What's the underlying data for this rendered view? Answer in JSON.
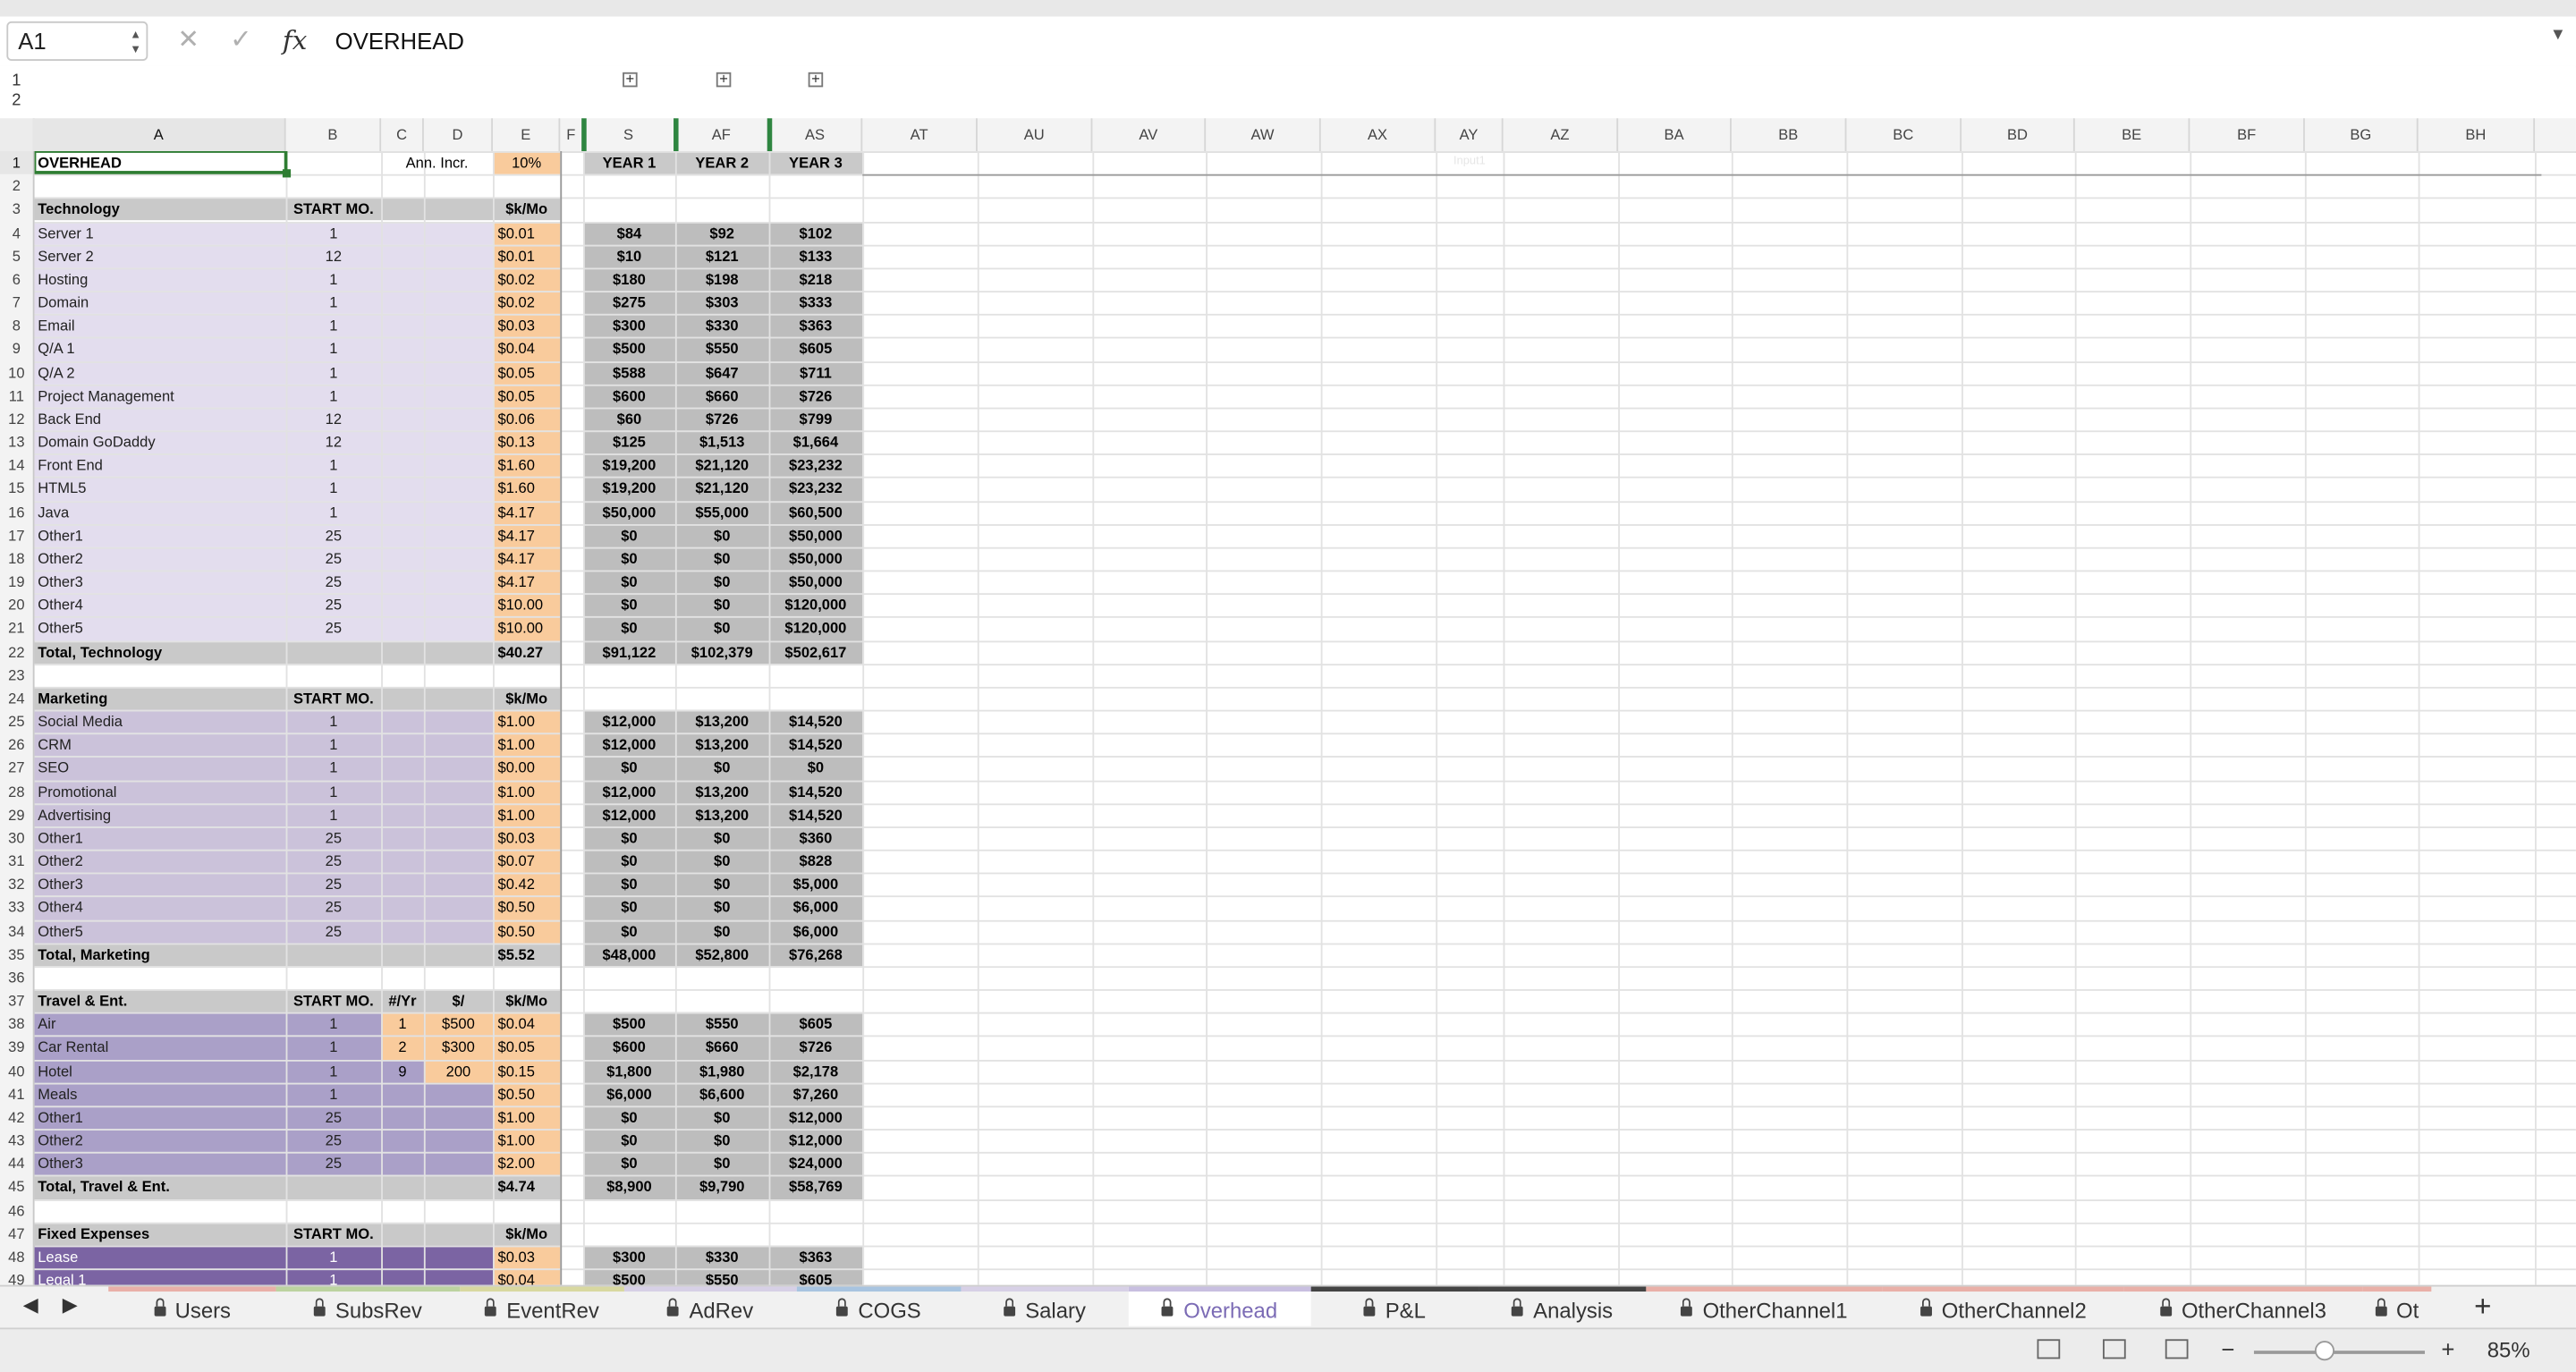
{
  "formula_bar": {
    "name_box": "A1",
    "formula": "OVERHEAD",
    "cancel_icon": "x-icon",
    "enter_icon": "check-icon",
    "fx_label": "fx"
  },
  "outline_levels": [
    "1",
    "2"
  ],
  "columns": [
    "A",
    "B",
    "C",
    "D",
    "E",
    "F",
    "S",
    "AF",
    "AS",
    "AT",
    "AU",
    "AV",
    "AW",
    "AX",
    "AY",
    "AZ",
    "BA",
    "BB",
    "BC",
    "BD",
    "BE",
    "BF",
    "BG",
    "BH"
  ],
  "colors": {
    "tech_bg": "#e3ddee",
    "mkt_bg": "#cbc2da",
    "travel_bg": "#aaa0c8",
    "fixed_bg": "#7b64a3",
    "orange": "#f9cb9c",
    "gray": "#bdbdbd",
    "header_gray": "#c9c9c9",
    "selection": "#2e7d32"
  },
  "sheet": {
    "a1": "OVERHEAD",
    "ann_incr_label": "Ann. Incr.",
    "ann_incr_value": "10%",
    "year_headers": [
      "YEAR 1",
      "YEAR 2",
      "YEAR 3"
    ],
    "ay_faint": "Input1",
    "start_mo_label": "START MO.",
    "unit_label": "$k/Mo",
    "yr_label": "#/Yr",
    "dollar_label": "$/",
    "sections": [
      {
        "name": "Technology",
        "header_row": 3,
        "theme": "tech",
        "rows": [
          {
            "n": 4,
            "label": "Server 1",
            "start": "1",
            "e": "$0.01",
            "y1": "$84",
            "y2": "$92",
            "y3": "$102"
          },
          {
            "n": 5,
            "label": "Server 2",
            "start": "12",
            "e": "$0.01",
            "y1": "$10",
            "y2": "$121",
            "y3": "$133"
          },
          {
            "n": 6,
            "label": "Hosting",
            "start": "1",
            "e": "$0.02",
            "y1": "$180",
            "y2": "$198",
            "y3": "$218"
          },
          {
            "n": 7,
            "label": "Domain",
            "start": "1",
            "e": "$0.02",
            "y1": "$275",
            "y2": "$303",
            "y3": "$333"
          },
          {
            "n": 8,
            "label": "Email",
            "start": "1",
            "e": "$0.03",
            "y1": "$300",
            "y2": "$330",
            "y3": "$363"
          },
          {
            "n": 9,
            "label": "Q/A 1",
            "start": "1",
            "e": "$0.04",
            "y1": "$500",
            "y2": "$550",
            "y3": "$605"
          },
          {
            "n": 10,
            "label": "Q/A 2",
            "start": "1",
            "e": "$0.05",
            "y1": "$588",
            "y2": "$647",
            "y3": "$711"
          },
          {
            "n": 11,
            "label": "Project Management",
            "start": "1",
            "e": "$0.05",
            "y1": "$600",
            "y2": "$660",
            "y3": "$726"
          },
          {
            "n": 12,
            "label": "Back End",
            "start": "12",
            "e": "$0.06",
            "y1": "$60",
            "y2": "$726",
            "y3": "$799"
          },
          {
            "n": 13,
            "label": "Domain GoDaddy",
            "start": "12",
            "e": "$0.13",
            "y1": "$125",
            "y2": "$1,513",
            "y3": "$1,664"
          },
          {
            "n": 14,
            "label": "Front End",
            "start": "1",
            "e": "$1.60",
            "y1": "$19,200",
            "y2": "$21,120",
            "y3": "$23,232"
          },
          {
            "n": 15,
            "label": "HTML5",
            "start": "1",
            "e": "$1.60",
            "y1": "$19,200",
            "y2": "$21,120",
            "y3": "$23,232"
          },
          {
            "n": 16,
            "label": "Java",
            "start": "1",
            "e": "$4.17",
            "y1": "$50,000",
            "y2": "$55,000",
            "y3": "$60,500"
          },
          {
            "n": 17,
            "label": "Other1",
            "start": "25",
            "e": "$4.17",
            "y1": "$0",
            "y2": "$0",
            "y3": "$50,000"
          },
          {
            "n": 18,
            "label": "Other2",
            "start": "25",
            "e": "$4.17",
            "y1": "$0",
            "y2": "$0",
            "y3": "$50,000"
          },
          {
            "n": 19,
            "label": "Other3",
            "start": "25",
            "e": "$4.17",
            "y1": "$0",
            "y2": "$0",
            "y3": "$50,000"
          },
          {
            "n": 20,
            "label": "Other4",
            "start": "25",
            "e": "$10.00",
            "y1": "$0",
            "y2": "$0",
            "y3": "$120,000"
          },
          {
            "n": 21,
            "label": "Other5",
            "start": "25",
            "e": "$10.00",
            "y1": "$0",
            "y2": "$0",
            "y3": "$120,000"
          }
        ],
        "total": {
          "n": 22,
          "label": "Total, Technology",
          "e": "$40.27",
          "y1": "$91,122",
          "y2": "$102,379",
          "y3": "$502,617"
        }
      },
      {
        "name": "Marketing",
        "header_row": 24,
        "theme": "mkt",
        "rows": [
          {
            "n": 25,
            "label": "Social Media",
            "start": "1",
            "e": "$1.00",
            "y1": "$12,000",
            "y2": "$13,200",
            "y3": "$14,520"
          },
          {
            "n": 26,
            "label": "CRM",
            "start": "1",
            "e": "$1.00",
            "y1": "$12,000",
            "y2": "$13,200",
            "y3": "$14,520"
          },
          {
            "n": 27,
            "label": "SEO",
            "start": "1",
            "e": "$0.00",
            "y1": "$0",
            "y2": "$0",
            "y3": "$0"
          },
          {
            "n": 28,
            "label": "Promotional",
            "start": "1",
            "e": "$1.00",
            "y1": "$12,000",
            "y2": "$13,200",
            "y3": "$14,520"
          },
          {
            "n": 29,
            "label": "Advertising",
            "start": "1",
            "e": "$1.00",
            "y1": "$12,000",
            "y2": "$13,200",
            "y3": "$14,520"
          },
          {
            "n": 30,
            "label": "Other1",
            "start": "25",
            "e": "$0.03",
            "y1": "$0",
            "y2": "$0",
            "y3": "$360"
          },
          {
            "n": 31,
            "label": "Other2",
            "start": "25",
            "e": "$0.07",
            "y1": "$0",
            "y2": "$0",
            "y3": "$828"
          },
          {
            "n": 32,
            "label": "Other3",
            "start": "25",
            "e": "$0.42",
            "y1": "$0",
            "y2": "$0",
            "y3": "$5,000"
          },
          {
            "n": 33,
            "label": "Other4",
            "start": "25",
            "e": "$0.50",
            "y1": "$0",
            "y2": "$0",
            "y3": "$6,000"
          },
          {
            "n": 34,
            "label": "Other5",
            "start": "25",
            "e": "$0.50",
            "y1": "$0",
            "y2": "$0",
            "y3": "$6,000"
          }
        ],
        "total": {
          "n": 35,
          "label": "Total, Marketing",
          "e": "$5.52",
          "y1": "$48,000",
          "y2": "$52,800",
          "y3": "$76,268"
        }
      },
      {
        "name": "Travel & Ent.",
        "header_row": 37,
        "theme": "travel",
        "extra_headers": true,
        "rows": [
          {
            "n": 38,
            "label": "Air",
            "start": "1",
            "c": "1",
            "d": "$500",
            "e": "$0.04",
            "y1": "$500",
            "y2": "$550",
            "y3": "$605"
          },
          {
            "n": 39,
            "label": "Car Rental",
            "start": "1",
            "c": "2",
            "d": "$300",
            "e": "$0.05",
            "y1": "$600",
            "y2": "$660",
            "y3": "$726"
          },
          {
            "n": 40,
            "label": "Hotel",
            "start": "1",
            "c": "9",
            "d": "200",
            "e": "$0.15",
            "y1": "$1,800",
            "y2": "$1,980",
            "y3": "$2,178"
          },
          {
            "n": 41,
            "label": "Meals",
            "start": "1",
            "e": "$0.50",
            "y1": "$6,000",
            "y2": "$6,600",
            "y3": "$7,260"
          },
          {
            "n": 42,
            "label": "Other1",
            "start": "25",
            "e": "$1.00",
            "y1": "$0",
            "y2": "$0",
            "y3": "$12,000"
          },
          {
            "n": 43,
            "label": "Other2",
            "start": "25",
            "e": "$1.00",
            "y1": "$0",
            "y2": "$0",
            "y3": "$12,000"
          },
          {
            "n": 44,
            "label": "Other3",
            "start": "25",
            "e": "$2.00",
            "y1": "$0",
            "y2": "$0",
            "y3": "$24,000"
          }
        ],
        "total": {
          "n": 45,
          "label": "Total, Travel & Ent.",
          "e": "$4.74",
          "y1": "$8,900",
          "y2": "$9,790",
          "y3": "$58,769"
        }
      },
      {
        "name": "Fixed Expenses",
        "header_row": 47,
        "theme": "fixed",
        "rows": [
          {
            "n": 48,
            "label": "Lease",
            "start": "1",
            "e": "$0.03",
            "y1": "$300",
            "y2": "$330",
            "y3": "$363"
          },
          {
            "n": 49,
            "label": "Legal 1",
            "start": "1",
            "e": "$0.04",
            "y1": "$500",
            "y2": "$550",
            "y3": "$605"
          }
        ]
      }
    ]
  },
  "tabs": [
    "Users",
    "SubsRev",
    "EventRev",
    "AdRev",
    "COGS",
    "Salary",
    "Overhead",
    "P&L",
    "Analysis",
    "OtherChannel1",
    "OtherChannel2",
    "OtherChannel3",
    "Ot"
  ],
  "active_tab": "Overhead",
  "status": {
    "zoom": "85%"
  }
}
